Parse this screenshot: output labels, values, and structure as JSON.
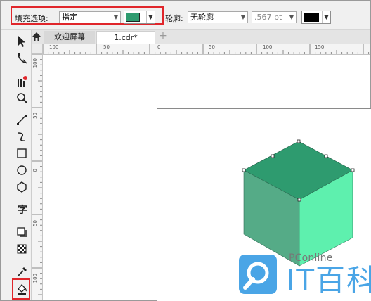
{
  "propbar": {
    "fill_label": "填充选项:",
    "fill_mode": "指定",
    "fill_color": "#2e9b6f",
    "outline_label": "轮廓:",
    "outline_value": "无轮廓",
    "width_value": ".567 pt",
    "outline_color": "#000000"
  },
  "tabs": [
    {
      "label": "欢迎屏幕"
    },
    {
      "label": "1.cdr*"
    }
  ],
  "hruler": {
    "labels": [
      "100",
      "50",
      "0",
      "50",
      "100",
      "150"
    ]
  },
  "vruler": {
    "labels": [
      "100",
      "50",
      "0",
      "50",
      "100"
    ]
  },
  "cube": {
    "top_color": "#2e9b6f",
    "left_color": "#55ab87",
    "right_color": "#5ef0ae"
  },
  "watermark": {
    "brand": "PConline",
    "name": "IT百科",
    "accent": "#4aa5e6"
  },
  "tools": [
    "pick-tool",
    "shape-tool",
    "crop-tool",
    "zoom-tool",
    "freehand-tool",
    "artistic-media-tool",
    "rectangle-tool",
    "ellipse-tool",
    "polygon-tool",
    "text-tool",
    "drop-shadow-tool",
    "transparency-tool",
    "eyedropper-tool",
    "interactive-fill-tool"
  ]
}
